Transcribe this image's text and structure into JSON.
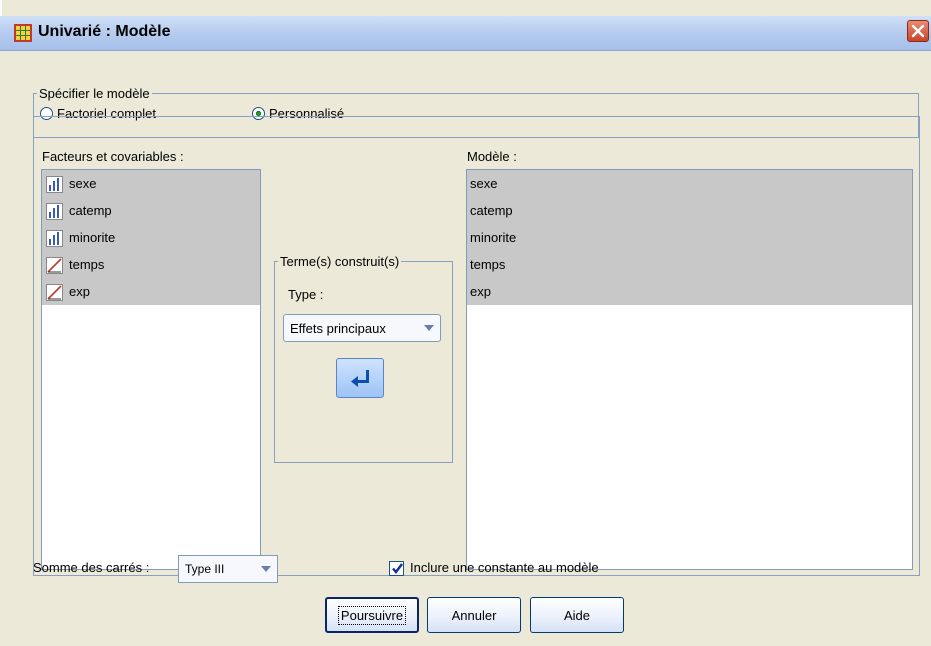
{
  "window": {
    "title": "Univarié : Modèle"
  },
  "spec_group": {
    "legend": "Spécifier le modèle",
    "radio_full": "Factoriel complet",
    "radio_custom": "Personnalisé",
    "selected": "Personnalisé"
  },
  "factors": {
    "label": "Facteurs et covariables :",
    "items": [
      {
        "name": "sexe",
        "icon": "nominal-variable-icon"
      },
      {
        "name": "catemp",
        "icon": "nominal-variable-icon"
      },
      {
        "name": "minorite",
        "icon": "nominal-variable-icon"
      },
      {
        "name": "temps",
        "icon": "scale-variable-icon"
      },
      {
        "name": "exp",
        "icon": "scale-variable-icon"
      }
    ]
  },
  "terms_group": {
    "legend": "Terme(s) construit(s)",
    "type_label": "Type :",
    "type_value": "Effets principaux",
    "move_icon": "arrow-move-icon"
  },
  "model": {
    "label": "Modèle :",
    "items": [
      "sexe",
      "catemp",
      "minorite",
      "temps",
      "exp"
    ]
  },
  "sum_squares": {
    "label": "Somme des carrés :",
    "value": "Type III"
  },
  "include_constant": {
    "label": "Inclure une constante au modèle",
    "checked": true
  },
  "buttons": {
    "continue": "Poursuivre",
    "cancel": "Annuler",
    "help": "Aide"
  },
  "colors": {
    "selection": "#c8c8c8",
    "titlebar": "#b8cdef",
    "panel": "#ece9d8"
  }
}
